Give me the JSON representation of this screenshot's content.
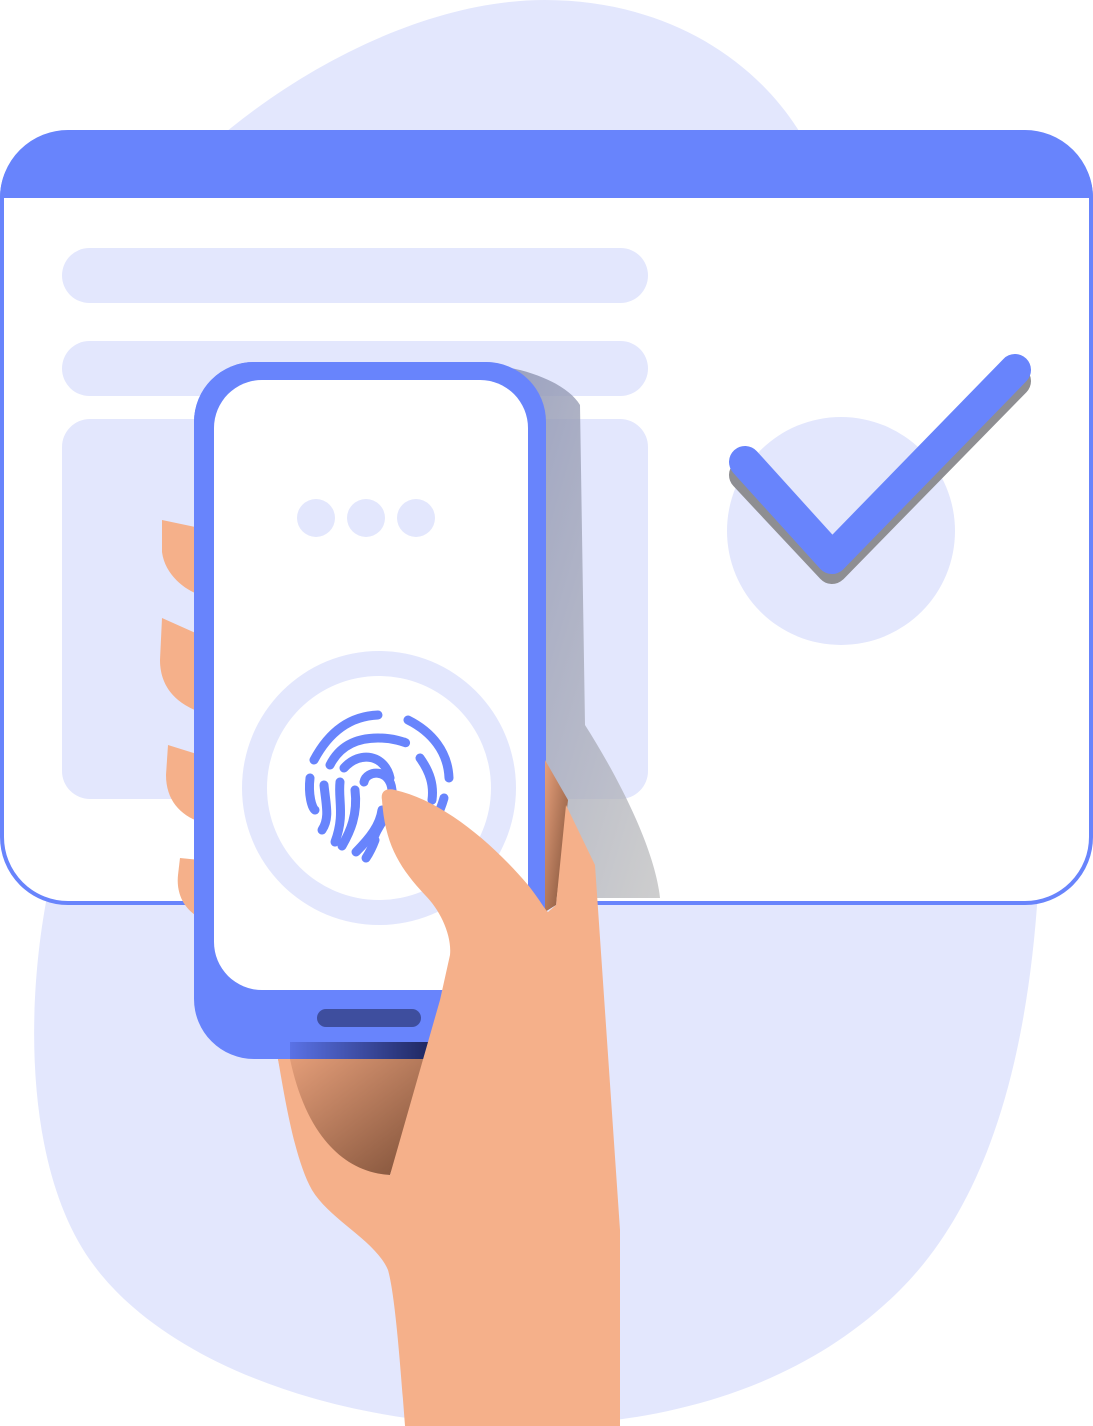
{
  "illustration": {
    "subject": "fingerprint-authentication",
    "icons": [
      "browser-window",
      "phone",
      "fingerprint-icon",
      "checkmark-icon",
      "hand"
    ]
  },
  "colors": {
    "accent": "#6884FC",
    "accent_dark": "#2A3473",
    "blob": "#E3E7FD",
    "placeholder": "#E3E7FD",
    "screen": "#FFFFFF",
    "skin": "#F5B08A",
    "skin_shadow": "#8F5F45",
    "phone_shadow": "#A3A9C3"
  },
  "phone": {
    "status_dots": 3,
    "auth_state": "verified"
  }
}
